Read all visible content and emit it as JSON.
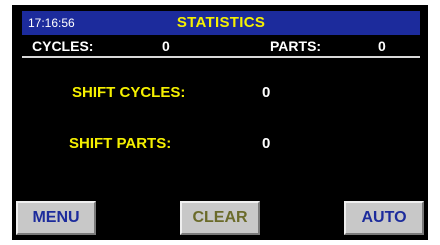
{
  "header": {
    "clock": "17:16:56",
    "title": "STATISTICS"
  },
  "summary": {
    "cycles_label": "CYCLES:",
    "cycles_value": "0",
    "parts_label": "PARTS:",
    "parts_value": "0"
  },
  "shift": {
    "cycles_label": "SHIFT CYCLES:",
    "cycles_value": "0",
    "parts_label": "SHIFT PARTS:",
    "parts_value": "0"
  },
  "buttons": {
    "menu": "MENU",
    "clear": "CLEAR",
    "auto": "AUTO"
  },
  "colors": {
    "title_bar": "#1c2b9c",
    "title_text": "#f5f000",
    "background": "#000000",
    "button_face": "#c8c8c8",
    "menu_auto_text": "#1c2b9c",
    "clear_text": "#6b6b2a"
  }
}
